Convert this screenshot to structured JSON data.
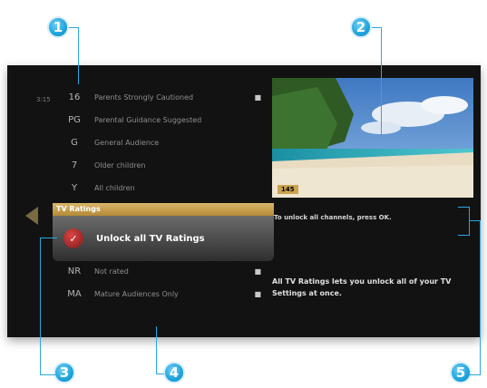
{
  "callouts": [
    "1",
    "2",
    "3",
    "4",
    "5"
  ],
  "clock": "3:15",
  "ratings_list": {
    "items_top": [
      {
        "icon": "rating-16-icon",
        "glyph": "16",
        "label": "Parents Strongly Cautioned",
        "locked": true
      },
      {
        "icon": "rating-pg-icon",
        "glyph": "PG",
        "label": "Parental Guidance Suggested",
        "locked": false
      },
      {
        "icon": "rating-g-icon",
        "glyph": "G",
        "label": "General Audience",
        "locked": false
      },
      {
        "icon": "rating-y7-icon",
        "glyph": "7",
        "label": "Older children",
        "locked": false
      },
      {
        "icon": "rating-y-icon",
        "glyph": "Y",
        "label": "All children",
        "locked": false
      }
    ],
    "header": "TV Ratings",
    "selected_label": "Unlock all TV Ratings",
    "items_bottom": [
      {
        "icon": "rating-nr-icon",
        "glyph": "NR",
        "label": "Not rated",
        "locked": true
      },
      {
        "icon": "rating-ma-icon",
        "glyph": "MA",
        "label": "Mature Audiences Only",
        "locked": true
      }
    ]
  },
  "preview": {
    "channel": "145"
  },
  "info": {
    "unlock_hint": "To unlock all channels, press OK.",
    "description": "All TV Ratings lets you unlock all of your TV Settings at once."
  },
  "colors": {
    "accent_blue": "#1ea3dc",
    "header_gold": "#c9a34f",
    "screen_bg": "#121212"
  }
}
